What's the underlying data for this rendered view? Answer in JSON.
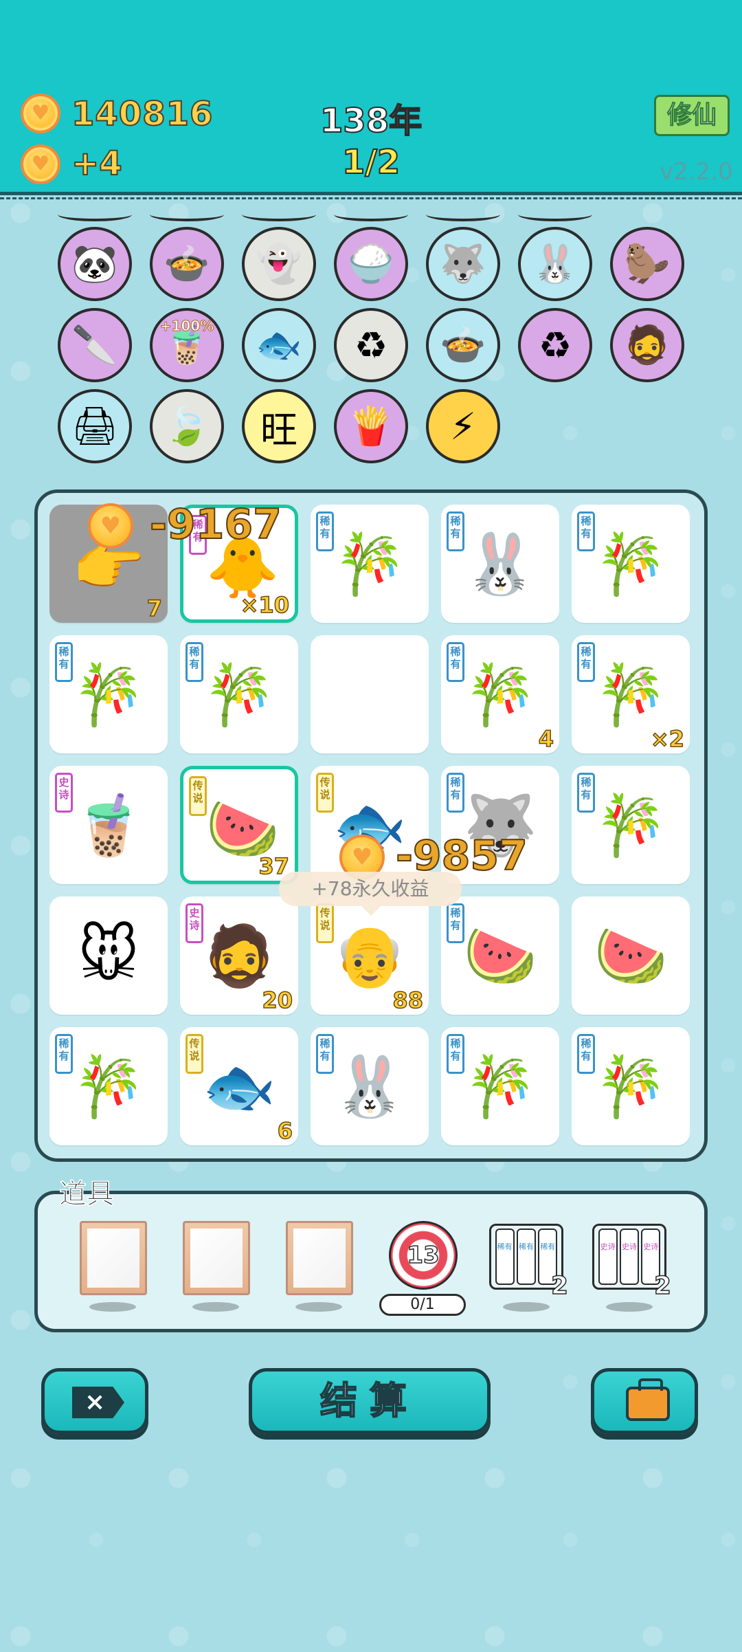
{
  "header": {
    "coins_total": "140816",
    "coins_rate": "+4",
    "year": "138年",
    "page_indicator": "1/2",
    "cultivate_button": "修仙",
    "version": "v2.2.0"
  },
  "upgrades": [
    {
      "icon": "panda-icon",
      "glyph": "🐼",
      "color": "#d9a8e6"
    },
    {
      "icon": "pot-duck-icon",
      "glyph": "🍲",
      "color": "#d9a8e6"
    },
    {
      "icon": "ghost-icon",
      "glyph": "👻",
      "color": "#e6e6e0"
    },
    {
      "icon": "rice-bowl-icon",
      "glyph": "🍚",
      "color": "#d9a8e6"
    },
    {
      "icon": "husky-icon",
      "glyph": "🐺",
      "color": "#b8e8f2"
    },
    {
      "icon": "rabbit-icon",
      "glyph": "🐰",
      "color": "#b8e8f2"
    },
    {
      "icon": "meerkats-icon",
      "glyph": "🦫",
      "color": "#d9a8e6"
    },
    {
      "icon": "cleaver-icon",
      "glyph": "🔪",
      "color": "#d9a8e6"
    },
    {
      "icon": "bubble-tea-icon",
      "glyph": "🧋",
      "color": "#d9a8e6",
      "label": "+100%"
    },
    {
      "icon": "fish-bowl-icon",
      "glyph": "🐟",
      "color": "#b8e8f2"
    },
    {
      "icon": "refresh-icon",
      "glyph": "♻",
      "color": "#e6e6e0"
    },
    {
      "icon": "pot-duck-icon",
      "glyph": "🍲",
      "color": "#b8e8f2"
    },
    {
      "icon": "recycle-icon",
      "glyph": "♻",
      "color": "#d9a8e6"
    },
    {
      "icon": "multiplier-man-icon",
      "glyph": "🧔",
      "color": "#d9a8e6"
    },
    {
      "icon": "printer-icon",
      "glyph": "🖨",
      "color": "#b8e8f2"
    },
    {
      "icon": "leaf-icon",
      "glyph": "🍃",
      "color": "#e6e6e0"
    },
    {
      "icon": "wang-tiles-icon",
      "glyph": "旺",
      "color": "#fff59a"
    },
    {
      "icon": "fries-icon",
      "glyph": "🍟",
      "color": "#d9a8e6"
    },
    {
      "icon": "lightning-icon",
      "glyph": "⚡",
      "color": "#ffd24a"
    }
  ],
  "board": {
    "cells": [
      {
        "item": "pointing-hand-icon",
        "glyph": "👉",
        "count": "7",
        "grey": true
      },
      {
        "item": "grandpa-chicken-icon",
        "glyph": "🐥",
        "count": "×10",
        "tag": "稀有",
        "tagtype": "epic",
        "highlight": true
      },
      {
        "item": "bamboo-icon",
        "glyph": "🎋",
        "tag": "稀有"
      },
      {
        "item": "rabbit-icon",
        "glyph": "🐰",
        "tag": "稀有"
      },
      {
        "item": "bamboo-icon",
        "glyph": "🎋",
        "tag": "稀有"
      },
      {
        "item": "bamboo-icon",
        "glyph": "🎋",
        "tag": "稀有"
      },
      {
        "item": "bamboo-icon",
        "glyph": "🎋",
        "tag": "稀有"
      },
      {
        "item": "empty",
        "glyph": ""
      },
      {
        "item": "bamboo-icon",
        "glyph": "🎋",
        "tag": "稀有",
        "count": "4"
      },
      {
        "item": "bamboo-icon",
        "glyph": "🎋",
        "tag": "稀有",
        "count": "×2"
      },
      {
        "item": "bubble-tea-icon",
        "glyph": "🧋",
        "tag": "史诗",
        "tagtype": "epic"
      },
      {
        "item": "watermelon-juice-icon",
        "glyph": "🍉",
        "tag": "传说",
        "tagtype": "legend",
        "count": "37",
        "highlight": true
      },
      {
        "item": "koi-fish-icon",
        "glyph": "🐟",
        "tag": "传说",
        "tagtype": "legend"
      },
      {
        "item": "husky-icon",
        "glyph": "🐺",
        "tag": "稀有"
      },
      {
        "item": "bamboo-icon",
        "glyph": "🎋",
        "tag": "稀有"
      },
      {
        "item": "mouse-icon",
        "glyph": "🐭"
      },
      {
        "item": "green-hat-man-icon",
        "glyph": "🧔",
        "tag": "史诗",
        "tagtype": "epic",
        "count": "20"
      },
      {
        "item": "glowing-elder-icon",
        "glyph": "👴",
        "tag": "传说",
        "tagtype": "legend",
        "count": "88"
      },
      {
        "item": "watermelon-icon",
        "glyph": "🍉",
        "tag": "稀有"
      },
      {
        "item": "watermelon-slice-icon",
        "glyph": "🍉"
      },
      {
        "item": "bamboo-icon",
        "glyph": "🎋",
        "tag": "稀有"
      },
      {
        "item": "koi-fish-icon",
        "glyph": "🐟",
        "tag": "传说",
        "tagtype": "legend",
        "count": "6"
      },
      {
        "item": "rabbit-icon",
        "glyph": "🐰",
        "tag": "稀有"
      },
      {
        "item": "bamboo-icon",
        "glyph": "🎋",
        "tag": "稀有"
      },
      {
        "item": "bamboo-icon",
        "glyph": "🎋",
        "tag": "稀有"
      }
    ],
    "float_loss_1": "-9167",
    "float_loss_2": "-9857",
    "bonus_bubble": "+78永久收益"
  },
  "props": {
    "title": "道具",
    "target_number": "13",
    "target_counter": "0/1",
    "cardset_rare_count": "2",
    "cardset_epic_count": "2",
    "card_rare_label": "稀有",
    "card_epic_label": "史诗"
  },
  "buttons": {
    "settle_label": "结算",
    "close_glyph": "×"
  }
}
